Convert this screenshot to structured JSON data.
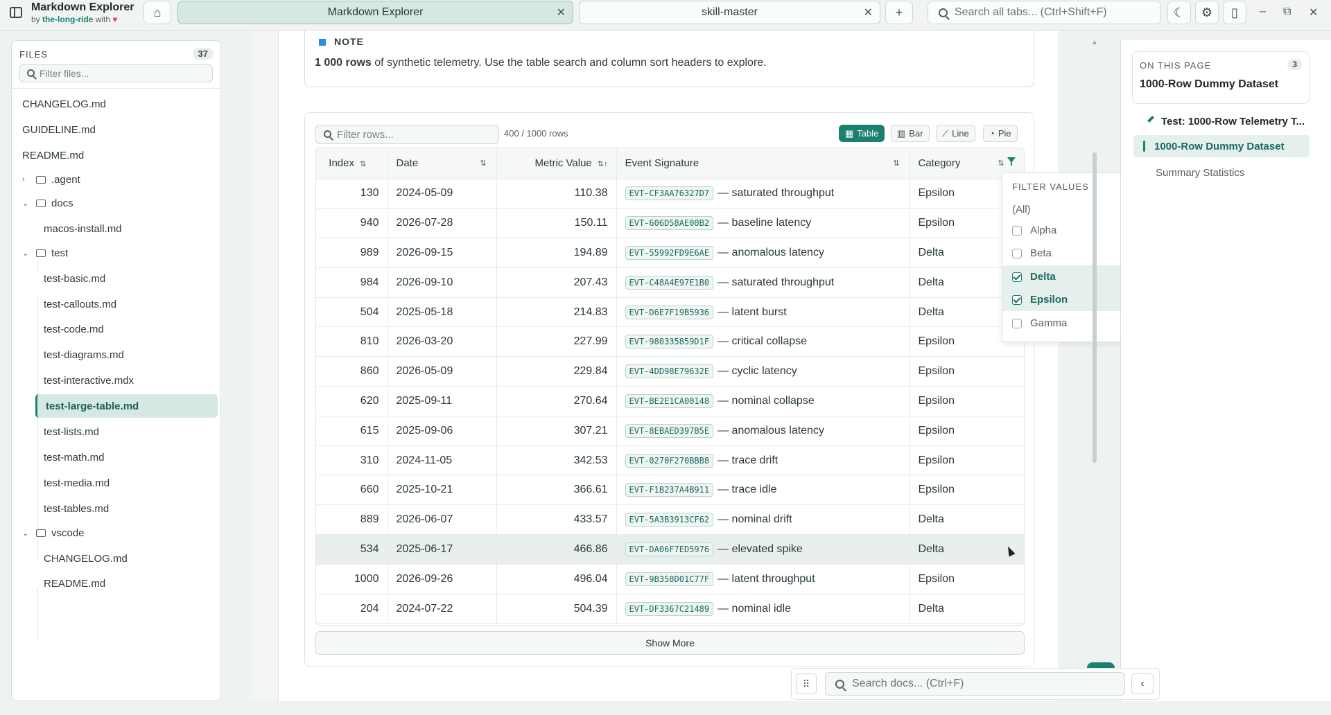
{
  "app": {
    "title": "Markdown Explorer",
    "sub_prefix": "by",
    "sub_brand": "the-long-ride",
    "sub_with": "with",
    "sub_heart": "♥"
  },
  "tabs": [
    {
      "label": "Markdown Explorer",
      "active": true
    },
    {
      "label": "skill-master",
      "active": false
    }
  ],
  "global_search": {
    "placeholder": "Search all tabs... (Ctrl+Shift+F)"
  },
  "sidebar": {
    "heading": "FILES",
    "count": "37",
    "filter_placeholder": "Filter files...",
    "items": [
      {
        "label": "CHANGELOG.md",
        "type": "file"
      },
      {
        "label": "GUIDELINE.md",
        "type": "file"
      },
      {
        "label": "README.md",
        "type": "file"
      },
      {
        "label": ".agent",
        "type": "folder",
        "state": "collapsed"
      },
      {
        "label": "docs",
        "type": "folder",
        "state": "expanded"
      },
      {
        "label": "macos-install.md",
        "type": "file"
      },
      {
        "label": "test",
        "type": "folder",
        "state": "expanded"
      },
      {
        "label": "test-basic.md",
        "type": "file"
      },
      {
        "label": "test-callouts.md",
        "type": "file"
      },
      {
        "label": "test-code.md",
        "type": "file"
      },
      {
        "label": "test-diagrams.md",
        "type": "file"
      },
      {
        "label": "test-interactive.mdx",
        "type": "file"
      },
      {
        "label": "test-large-table.md",
        "type": "file",
        "active": true
      },
      {
        "label": "test-lists.md",
        "type": "file"
      },
      {
        "label": "test-math.md",
        "type": "file"
      },
      {
        "label": "test-media.md",
        "type": "file"
      },
      {
        "label": "test-tables.md",
        "type": "file"
      },
      {
        "label": "vscode",
        "type": "folder",
        "state": "expanded"
      },
      {
        "label": "CHANGELOG.md",
        "type": "file"
      },
      {
        "label": "README.md",
        "type": "file"
      }
    ]
  },
  "note": {
    "title": "NOTE",
    "bold": "1 000 rows",
    "text": "of synthetic telemetry. Use the table search and column sort headers to explore."
  },
  "table_view": {
    "filter_placeholder": "Filter rows...",
    "row_count": "400 / 1000 rows",
    "views": [
      "Table",
      "Bar",
      "Line",
      "Pie"
    ],
    "active_view": "Table",
    "columns": [
      "Index",
      "Date",
      "Metric Value",
      "Event Signature",
      "Category"
    ],
    "rows": [
      [
        "130",
        "2024-05-09",
        "110.38",
        "EVT-CF3AA76327D7",
        "— saturated throughput",
        "Epsilon"
      ],
      [
        "940",
        "2026-07-28",
        "150.11",
        "EVT-606D58AE00B2",
        "— baseline latency",
        "Epsilon"
      ],
      [
        "989",
        "2026-09-15",
        "194.89",
        "EVT-55992FD9E6AE",
        "— anomalous latency",
        "Delta"
      ],
      [
        "984",
        "2026-09-10",
        "207.43",
        "EVT-C48A4E97E1B0",
        "— saturated throughput",
        "Delta"
      ],
      [
        "504",
        "2025-05-18",
        "214.83",
        "EVT-D6E7F19B5936",
        "— latent burst",
        "Delta"
      ],
      [
        "810",
        "2026-03-20",
        "227.99",
        "EVT-980335859D1F",
        "— critical collapse",
        "Epsilon"
      ],
      [
        "860",
        "2026-05-09",
        "229.84",
        "EVT-4DD98E79632E",
        "— cyclic latency",
        "Epsilon"
      ],
      [
        "620",
        "2025-09-11",
        "270.64",
        "EVT-BE2E1CA00148",
        "— nominal collapse",
        "Epsilon"
      ],
      [
        "615",
        "2025-09-06",
        "307.21",
        "EVT-8EBAED397B5E",
        "— anomalous latency",
        "Epsilon"
      ],
      [
        "310",
        "2024-11-05",
        "342.53",
        "EVT-0270F270BBB8",
        "— trace drift",
        "Epsilon"
      ],
      [
        "660",
        "2025-10-21",
        "366.61",
        "EVT-F1B237A4B911",
        "— trace idle",
        "Epsilon"
      ],
      [
        "889",
        "2026-06-07",
        "433.57",
        "EVT-5A3B3913CF62",
        "— nominal drift",
        "Delta"
      ],
      [
        "534",
        "2025-06-17",
        "466.86",
        "EVT-DA06F7ED5976",
        "— elevated spike",
        "Delta"
      ],
      [
        "1000",
        "2026-09-26",
        "496.04",
        "EVT-9B358D01C77F",
        "— latent throughput",
        "Epsilon"
      ],
      [
        "204",
        "2024-07-22",
        "504.39",
        "EVT-DF3367C21489",
        "— nominal idle",
        "Delta"
      ]
    ],
    "highlighted_row": "534",
    "show_more": "Show More"
  },
  "filter_popup": {
    "heading": "FILTER VALUES",
    "all_label": "(All)",
    "options": [
      {
        "label": "Alpha",
        "checked": false
      },
      {
        "label": "Beta",
        "checked": false
      },
      {
        "label": "Delta",
        "checked": true
      },
      {
        "label": "Epsilon",
        "checked": true
      },
      {
        "label": "Gamma",
        "checked": false
      }
    ]
  },
  "toc": {
    "heading": "ON THIS PAGE",
    "count": "3",
    "title": "1000-Row Dummy Dataset",
    "items": [
      {
        "label": "Test: 1000-Row Telemetry T...",
        "level": "h1"
      },
      {
        "label": "1000-Row Dummy Dataset",
        "level": "h2",
        "active": true
      },
      {
        "label": "Summary Statistics",
        "level": "h2"
      }
    ]
  },
  "doc_search": {
    "placeholder": "Search docs... (Ctrl+F)"
  },
  "colors": {
    "accent": "#1a8070",
    "active_bg": "#d6e8e3",
    "heart": "#e0405a",
    "note_marker": "#2a8fd8"
  }
}
